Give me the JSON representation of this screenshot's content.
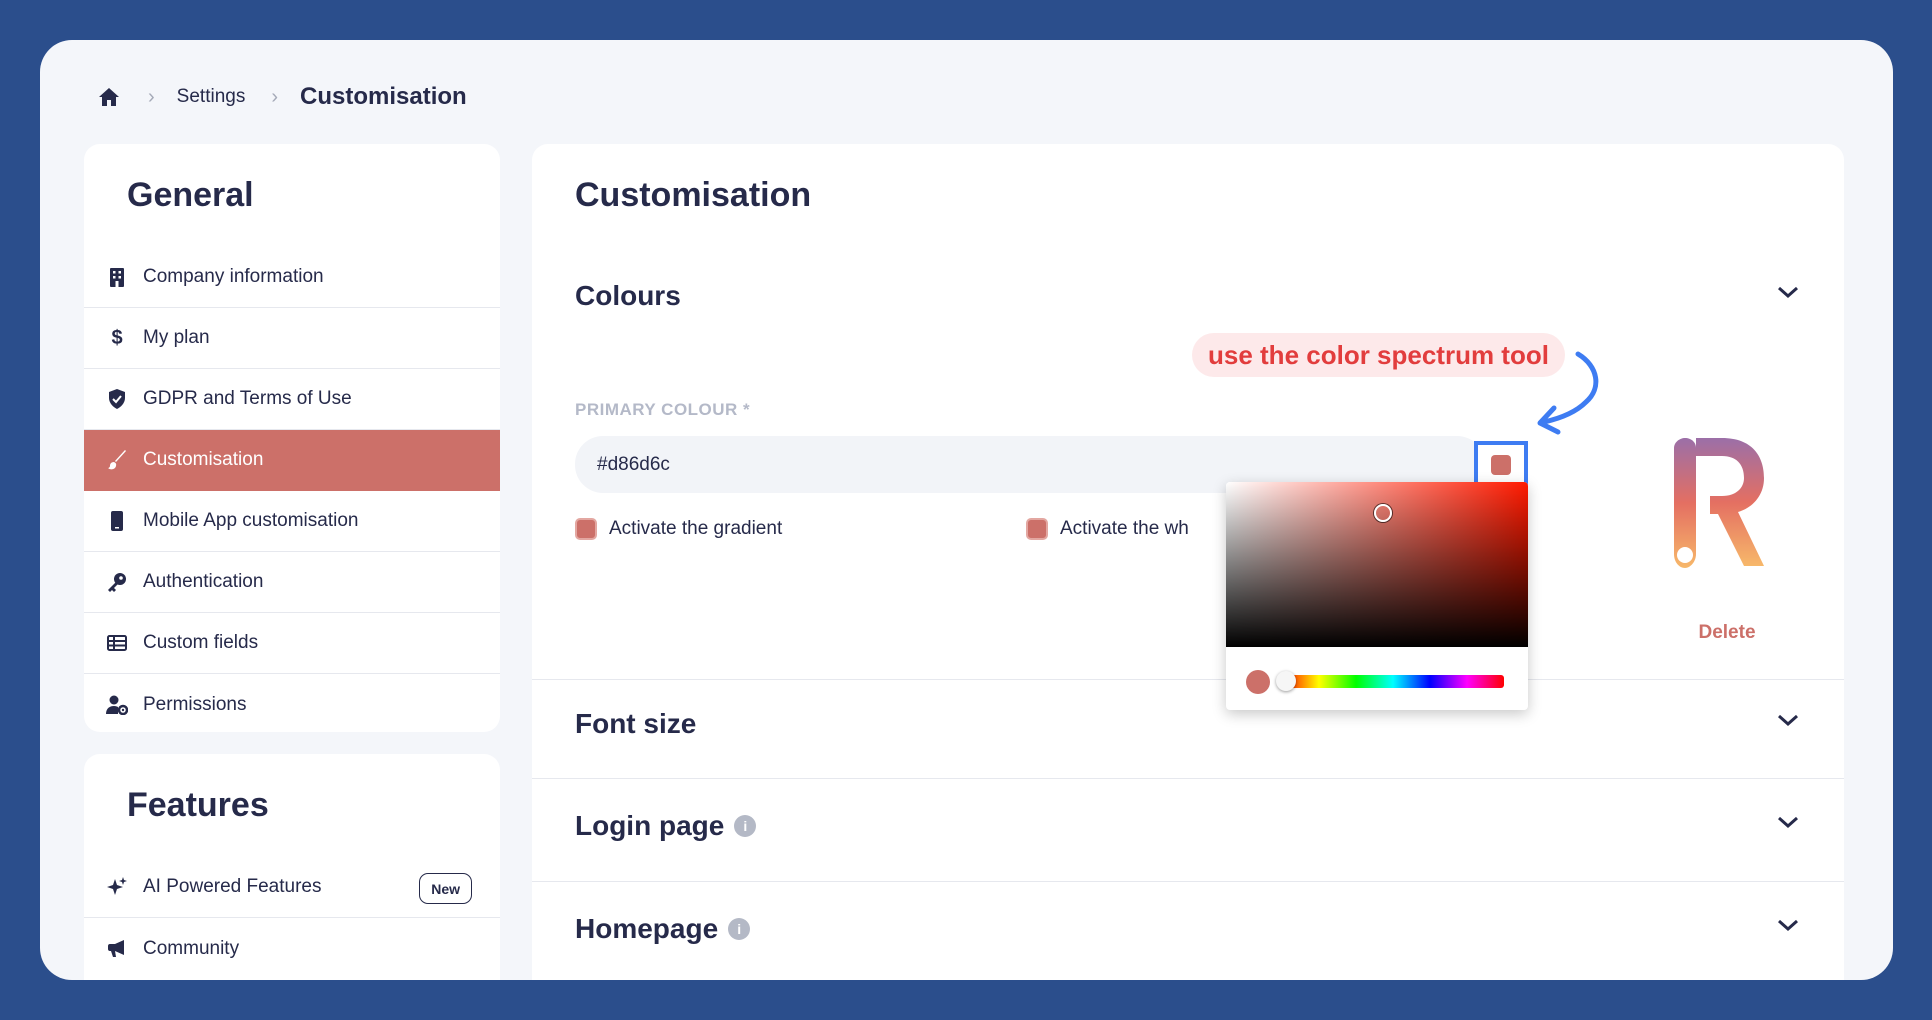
{
  "breadcrumb": {
    "home_icon": "home-icon",
    "items": [
      "Settings",
      "Customisation"
    ]
  },
  "sidebar_general": {
    "heading": "General",
    "items": [
      {
        "label": "Company information",
        "icon": "building-icon"
      },
      {
        "label": "My plan",
        "icon": "dollar-icon"
      },
      {
        "label": "GDPR and Terms of Use",
        "icon": "shield-icon"
      },
      {
        "label": "Customisation",
        "icon": "brush-icon",
        "active": true
      },
      {
        "label": "Mobile App customisation",
        "icon": "mobile-icon"
      },
      {
        "label": "Authentication",
        "icon": "key-icon"
      },
      {
        "label": "Custom fields",
        "icon": "table-icon"
      },
      {
        "label": "Permissions",
        "icon": "user-gear-icon"
      }
    ]
  },
  "sidebar_features": {
    "heading": "Features",
    "items": [
      {
        "label": "AI Powered Features",
        "icon": "sparkles-icon",
        "badge": "New"
      },
      {
        "label": "Community",
        "icon": "megaphone-icon"
      }
    ]
  },
  "main": {
    "title": "Customisation",
    "colours": {
      "title": "Colours",
      "primary_label": "PRIMARY COLOUR *",
      "primary_value": "#d86d6c",
      "checkbox_gradient": "Activate the gradient",
      "checkbox_white": "Activate the wh",
      "delete_label": "Delete"
    },
    "sections": [
      {
        "title": "Font size"
      },
      {
        "title": "Login page",
        "info": "i"
      },
      {
        "title": "Homepage",
        "info": "i"
      }
    ]
  },
  "annotation": {
    "text": "use the color spectrum tool"
  },
  "colors": {
    "accent": "#cc7069",
    "highlight": "#3e7cf2",
    "annotation_text": "#e23d3d",
    "background": "#2b4e8c"
  }
}
